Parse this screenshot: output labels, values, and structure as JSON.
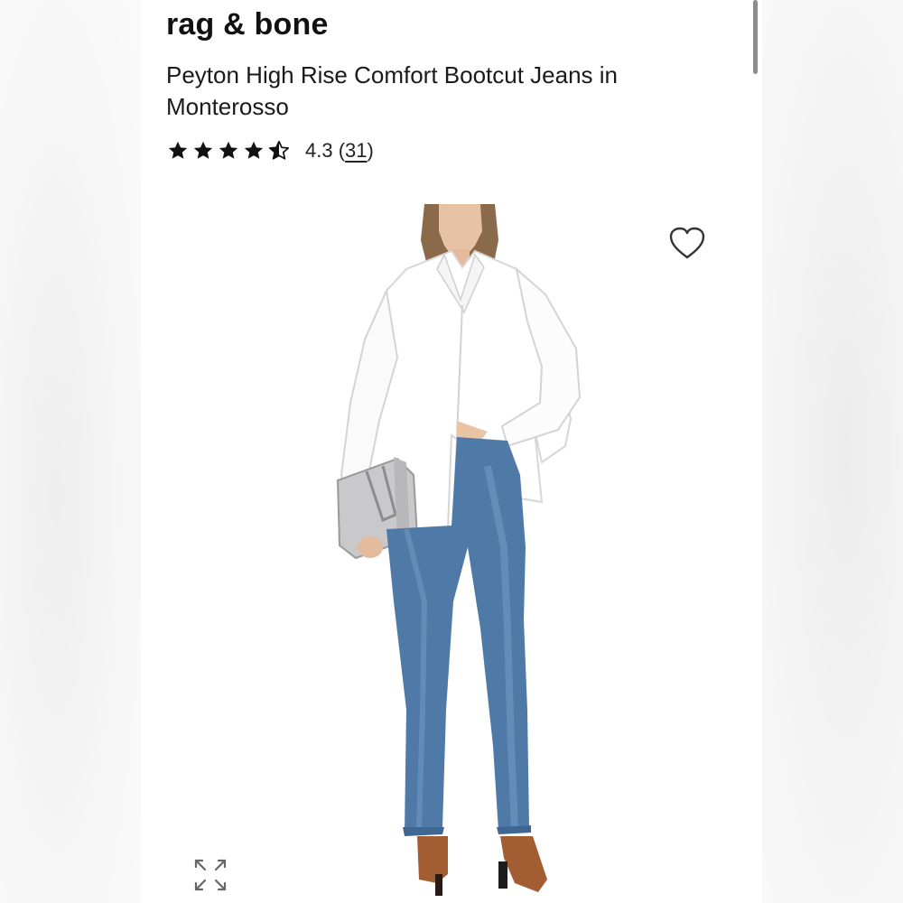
{
  "product": {
    "brand": "rag & bone",
    "title": "Peyton High Rise Comfort Bootcut Jeans in Monterosso",
    "rating": {
      "value": 4.3,
      "value_text": "4.3",
      "open_paren": "(",
      "review_count": "31",
      "close_paren": ")",
      "stars_max": 5
    }
  },
  "icons": {
    "favorite": "heart-outline-icon",
    "expand": "expand-arrows-icon",
    "star": "star-icon"
  },
  "colors": {
    "text": "#111111",
    "background": "#ffffff",
    "scrollbar": "#8c8c8c",
    "denim": "#4f7aa8"
  }
}
